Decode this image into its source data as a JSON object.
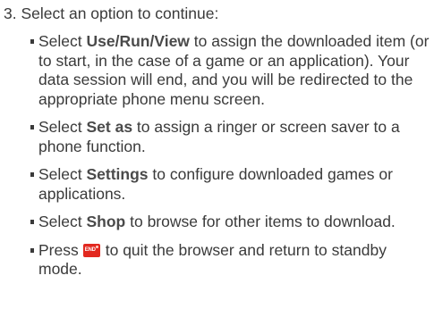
{
  "step": {
    "number": "3.",
    "text": "Select an option to continue:"
  },
  "items": [
    {
      "prefix": "Select ",
      "bold": "Use/Run/View",
      "suffix": " to assign the downloaded item (or to start, in the case of a game or an application). Your data session will end, and you will be redirected to the appropriate phone menu screen."
    },
    {
      "prefix": "Select ",
      "bold": "Set as",
      "suffix": " to assign a ringer or screen saver to a phone function."
    },
    {
      "prefix": "Select ",
      "bold": "Settings",
      "suffix": " to configure downloaded games or applications."
    },
    {
      "prefix": "Select ",
      "bold": "Shop",
      "suffix": " to browse for other items to download."
    },
    {
      "prefix": "Press",
      "key_label": "END",
      "key_icon": "end-key-icon",
      "suffix": "to quit the browser and return to standby mode."
    }
  ],
  "colors": {
    "text": "#3a3a3a",
    "end_key": "#e2281f"
  }
}
